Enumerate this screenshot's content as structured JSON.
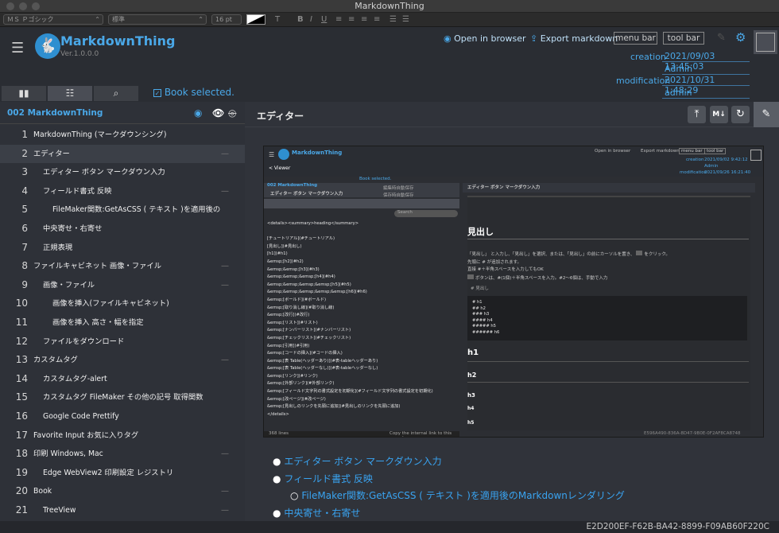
{
  "window": {
    "title": "MarkdownThing"
  },
  "format_bar": {
    "font": "ＭＳ Ｐゴシック",
    "style": "標準",
    "size": "16 pt",
    "bold": "B",
    "italic": "I",
    "underline": "U"
  },
  "app": {
    "name": "MarkdownThing",
    "version": "Ver.1.0.0.0",
    "accent": "#4aa8e8"
  },
  "toolbar": {
    "open_in_browser": "Open in browser",
    "export_markdown": "Export markdown",
    "menu_bar": "menu bar",
    "tool_bar": "tool bar"
  },
  "meta": {
    "creation_label": "creation",
    "creation_value": "2021/09/03 13:45:03",
    "creation_user": "Admin",
    "modification_label": "modification",
    "modification_value": "2021/10/31 1:48:29",
    "modification_user": "admin"
  },
  "tabs": {
    "book_selected": "Book selected."
  },
  "sidebar": {
    "book_title": "002 MarkdownThing",
    "items": [
      {
        "num": "1",
        "label": "MarkdownThing (マークダウンシング)",
        "indent": 0,
        "dash": false
      },
      {
        "num": "2",
        "label": "エディター",
        "indent": 0,
        "dash": true
      },
      {
        "num": "3",
        "label": "エディター ボタン マークダウン入力",
        "indent": 1,
        "dash": false
      },
      {
        "num": "4",
        "label": "フィールド書式 反映",
        "indent": 1,
        "dash": true
      },
      {
        "num": "5",
        "label": "FileMaker関数:GetAsCSS ( テキスト )を適用後の",
        "indent": 2,
        "dash": false
      },
      {
        "num": "6",
        "label": "中央寄せ・右寄せ",
        "indent": 1,
        "dash": false
      },
      {
        "num": "7",
        "label": "正規表現",
        "indent": 1,
        "dash": false
      },
      {
        "num": "8",
        "label": "ファイルキャビネット 画像・ファイル",
        "indent": 0,
        "dash": true
      },
      {
        "num": "9",
        "label": "画像・ファイル",
        "indent": 1,
        "dash": true
      },
      {
        "num": "10",
        "label": "画像を挿入(ファイルキャビネット)",
        "indent": 2,
        "dash": false
      },
      {
        "num": "11",
        "label": "画像を挿入 高さ・幅を指定",
        "indent": 2,
        "dash": false
      },
      {
        "num": "12",
        "label": "ファイルをダウンロード",
        "indent": 1,
        "dash": false
      },
      {
        "num": "13",
        "label": "カスタムタグ",
        "indent": 0,
        "dash": true
      },
      {
        "num": "14",
        "label": "カスタムタグ-alert",
        "indent": 1,
        "dash": false
      },
      {
        "num": "15",
        "label": "カスタムタグ FileMaker その他の記号 取得関数",
        "indent": 1,
        "dash": false
      },
      {
        "num": "16",
        "label": "Google Code Prettify",
        "indent": 1,
        "dash": false
      },
      {
        "num": "17",
        "label": "Favorite Input お気に入りタグ",
        "indent": 0,
        "dash": false
      },
      {
        "num": "18",
        "label": "印刷 Windows, Mac",
        "indent": 0,
        "dash": true
      },
      {
        "num": "19",
        "label": "Edge WebView2 印刷設定 レジストリ",
        "indent": 1,
        "dash": false
      },
      {
        "num": "20",
        "label": "Book",
        "indent": 0,
        "dash": true
      },
      {
        "num": "21",
        "label": "TreeView",
        "indent": 1,
        "dash": true
      }
    ]
  },
  "main": {
    "title": "エディター",
    "btn_md": "M↓"
  },
  "inner": {
    "app_name": "MarkdownThing",
    "viewer": "< Viewer",
    "book_selected": "Book selected.",
    "open": "Open in browser",
    "export": "Export markdown",
    "menu": "menu bar",
    "tool": "tool bar",
    "creation_label": "creation",
    "creation": "2021/09/02 9:42:12",
    "creation_user": "Admin",
    "mod_label": "modification",
    "modification": "2021/09/26 16:21:40",
    "mod_user": "Admin",
    "book": "002 MarkdownThing",
    "doc_title": "エディター ボタン マークダウン入力",
    "opt1": "編集時自動保存",
    "opt2": "保存時自動保存",
    "search": "Search",
    "right_title": "エディター ボタン マークダウン入力",
    "lines_count": "368 lines",
    "copy_link": "Copy the internal link to this record",
    "uuid": "E596A490-836A-8D47-9B0E-0F2AF8CA8748",
    "code_lines": [
      "<details><summary>heading</summary>",
      "",
      "[チュートリアル](#チュートリアル)",
      "[見出し](#見出し)",
      "[h1](#h1)",
      "&emsp;[h2](#h2)",
      "&emsp;&emsp;[h3](#h3)",
      "&emsp;&emsp;&emsp;[h4](#h4)",
      "&emsp;&emsp;&emsp;&emsp;[h5](#h5)",
      "&emsp;&emsp;&emsp;&emsp;&emsp;[h6](#h6)",
      "&emsp;[ボールド](#ボールド)",
      "&emsp;[取り消し線](#取り消し線)",
      "&emsp;[改行](#改行)",
      "&emsp;[リスト](#リスト)",
      "&emsp;[ナンバーリスト](#ナンバーリスト)",
      "&emsp;[チェックリスト](#チェックリスト)",
      "&emsp;[引用](#引用)",
      "&emsp;[コードの挿入](#コードの挿入)",
      "&emsp;[表 Table(ヘッダーあり)](#表-tableヘッダーあり)",
      "&emsp;[表 Table(ヘッダーなし)](#表-tableヘッダーなし)",
      "&emsp;[リンク](#リンク)",
      "&emsp;[外部リンク](#外部リンク)",
      "&emsp;[フィールド文字列の書式設定を初期化](#フィールド文字列の書式設定を初期化)",
      "&emsp;[改ページ](#改ページ)",
      "&emsp;[見出しのリンクを先頭に追加](#見出しのリンクを先頭に追加)",
      "</details>"
    ],
    "midashi": "見出し",
    "para1": "「見出し」 と入力し、「見出し」を選択、または、「見出し」の前にカーソルを置き、",
    "para1b": "をクリック。",
    "para2": "先頭に # が追加されます。",
    "para3": "直接 #＋半角スペースを入力してもOK",
    "para4": "ボタンは、#(1個)＋半角スペースを入力。#2〜6個は、手動で入力",
    "para5": "# 見出し",
    "code_block": [
      "# h1",
      "## h2",
      "### h3",
      "#### h4",
      "##### h5",
      "###### h6"
    ],
    "h1": "h1",
    "h2": "h2",
    "h3": "h3",
    "h4": "h4",
    "h5": "h5"
  },
  "bullets": [
    "エディター ボタン マークダウン入力",
    "フィールド書式 反映",
    "FileMaker関数:GetAsCSS ( テキスト )を適用後のMarkdownレンダリング",
    "中央寄せ・右寄せ"
  ],
  "status": {
    "uuid": "E2D200EF-F62B-BA42-8899-F09AB60F220C"
  }
}
